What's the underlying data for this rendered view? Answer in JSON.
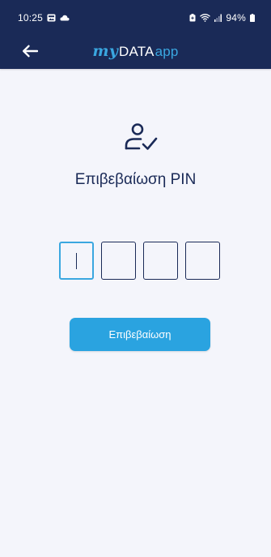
{
  "status_bar": {
    "time": "10:25",
    "battery": "94%",
    "left_icons": [
      "gallery-icon",
      "cloud-icon"
    ],
    "right_icons": [
      "battery-saver-icon",
      "wifi-icon",
      "signal-icon",
      "battery-icon"
    ]
  },
  "header": {
    "logo_my": "my",
    "logo_data": "DATA",
    "logo_app": "app",
    "back_icon": "arrow-left-icon"
  },
  "main": {
    "icon": "user-check-icon",
    "title": "Επιβεβαίωση PIN",
    "pin_fields": [
      {
        "value": "",
        "active": true
      },
      {
        "value": "",
        "active": false
      },
      {
        "value": "",
        "active": false
      },
      {
        "value": "",
        "active": false
      }
    ],
    "confirm_label": "Επιβεβαίωση"
  },
  "colors": {
    "header_bg": "#1a2a57",
    "accent": "#2aa3e0",
    "page_bg": "#f4f5fb",
    "text_primary": "#1a2a57"
  }
}
